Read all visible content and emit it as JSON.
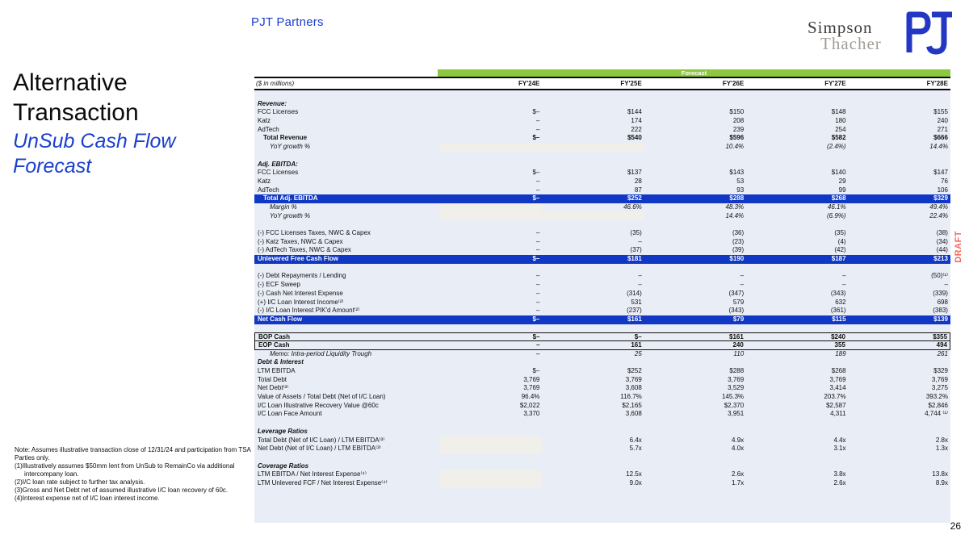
{
  "header": {
    "brand": "PJT Partners",
    "simpson_line1": "Simpson",
    "simpson_line2": "Thacher",
    "pjt_logo": "PJT"
  },
  "title": {
    "line1": "Alternative",
    "line2": "Transaction",
    "sub_line1": "UnSub Cash Flow",
    "sub_line2": "Forecast"
  },
  "watermark": "DRAFT",
  "page_number": "26",
  "colors": {
    "accent_blue": "#1b3cd0",
    "highlight_row_blue": "#1138c4",
    "forecast_green": "#8dc63f",
    "table_panel": "#e9edf6",
    "shaded_cell": "#f0efe9",
    "draft_red": "#f2685e"
  },
  "table": {
    "units_label": "($ in millions)",
    "forecast_label": "Forecast",
    "columns": [
      "FY'24E",
      "FY'25E",
      "FY'26E",
      "FY'27E",
      "FY'28E"
    ],
    "rows": [
      {
        "t": "spacer"
      },
      {
        "t": "section",
        "label": "Revenue:"
      },
      {
        "t": "item",
        "label": "FCC Licenses",
        "v": [
          "$–",
          "$144",
          "$150",
          "$148",
          "$155"
        ]
      },
      {
        "t": "item",
        "label": "Katz",
        "v": [
          "–",
          "174",
          "208",
          "180",
          "240"
        ]
      },
      {
        "t": "item",
        "label": "AdTech",
        "v": [
          "–",
          "222",
          "239",
          "254",
          "271"
        ]
      },
      {
        "t": "total",
        "label": "Total Revenue",
        "indent": 1,
        "v": [
          "$–",
          "$540",
          "$596",
          "$582",
          "$666"
        ]
      },
      {
        "t": "pct",
        "label": "YoY growth %",
        "indent": 2,
        "shade": 2,
        "v": [
          "",
          "",
          "10.4%",
          "(2.4%)",
          "14.4%"
        ]
      },
      {
        "t": "spacer"
      },
      {
        "t": "section",
        "label": "Adj. EBITDA:"
      },
      {
        "t": "item",
        "label": "FCC Licenses",
        "v": [
          "$–",
          "$137",
          "$143",
          "$140",
          "$147"
        ]
      },
      {
        "t": "item",
        "label": "Katz",
        "v": [
          "–",
          "28",
          "53",
          "29",
          "76"
        ]
      },
      {
        "t": "item",
        "label": "AdTech",
        "v": [
          "–",
          "87",
          "93",
          "99",
          "106"
        ]
      },
      {
        "t": "blue",
        "label": "Total Adj. EBITDA",
        "indent": 1,
        "v": [
          "$–",
          "$252",
          "$288",
          "$268",
          "$329"
        ]
      },
      {
        "t": "pct",
        "label": "Margin %",
        "indent": 2,
        "shade": 1,
        "v": [
          "",
          "46.6%",
          "48.3%",
          "46.1%",
          "49.4%"
        ]
      },
      {
        "t": "pct",
        "label": "YoY growth %",
        "indent": 2,
        "shade": 2,
        "v": [
          "",
          "",
          "14.4%",
          "(6.9%)",
          "22.4%"
        ]
      },
      {
        "t": "spacer"
      },
      {
        "t": "item",
        "label": "(-) FCC Licenses Taxes, NWC & Capex",
        "v": [
          "–",
          "(35)",
          "(36)",
          "(35)",
          "(38)"
        ]
      },
      {
        "t": "item",
        "label": "(-) Katz Taxes, NWC & Capex",
        "v": [
          "–",
          "–",
          "(23)",
          "(4)",
          "(34)"
        ]
      },
      {
        "t": "item",
        "label": "(-) AdTech Taxes, NWC & Capex",
        "v": [
          "–",
          "(37)",
          "(39)",
          "(42)",
          "(44)"
        ]
      },
      {
        "t": "blue",
        "label": "Unlevered Free Cash Flow",
        "v": [
          "$–",
          "$181",
          "$190",
          "$187",
          "$213"
        ]
      },
      {
        "t": "spacer"
      },
      {
        "t": "item",
        "label": "(-) Debt Repayments / Lending",
        "v": [
          "–",
          "–",
          "–",
          "–",
          "(50)⁽¹⁾"
        ]
      },
      {
        "t": "item",
        "label": "(-) ECF Sweep",
        "v": [
          "–",
          "–",
          "–",
          "–",
          "–"
        ]
      },
      {
        "t": "item",
        "label": "(-) Cash Net Interest Expense",
        "v": [
          "–",
          "(314)",
          "(347)",
          "(343)",
          "(339)"
        ]
      },
      {
        "t": "item",
        "label": "(+) I/C Loan Interest Income⁽²⁾",
        "v": [
          "–",
          "531",
          "579",
          "632",
          "698"
        ]
      },
      {
        "t": "item",
        "label": "(-) I/C Loan Interest PIK'd Amount⁽²⁾",
        "v": [
          "–",
          "(237)",
          "(343)",
          "(361)",
          "(383)"
        ]
      },
      {
        "t": "blue",
        "label": "Net Cash Flow",
        "v": [
          "$–",
          "$161",
          "$79",
          "$115",
          "$139"
        ]
      },
      {
        "t": "spacer"
      },
      {
        "t": "boxtop",
        "label": "BOP Cash",
        "v": [
          "$–",
          "$–",
          "$161",
          "$240",
          "$355"
        ]
      },
      {
        "t": "boxbottom",
        "label": "EOP Cash",
        "v": [
          "–",
          "161",
          "240",
          "355",
          "494"
        ]
      },
      {
        "t": "memo",
        "label": "Memo: Intra-period Liquidity Trough",
        "indent": 2,
        "v": [
          "–",
          "25",
          "110",
          "189",
          "261"
        ]
      },
      {
        "t": "section",
        "label": "Debt & Interest"
      },
      {
        "t": "item",
        "label": "LTM EBITDA",
        "v": [
          "$–",
          "$252",
          "$288",
          "$268",
          "$329"
        ]
      },
      {
        "t": "item",
        "label": "Total Debt",
        "v": [
          "3,769",
          "3,769",
          "3,769",
          "3,769",
          "3,769"
        ]
      },
      {
        "t": "item",
        "label": "Net Debt⁽³⁾",
        "v": [
          "3,769",
          "3,608",
          "3,529",
          "3,414",
          "3,275"
        ]
      },
      {
        "t": "item",
        "label": "Value of Assets / Total Debt (Net of I/C Loan)",
        "v": [
          "96.4%",
          "116.7%",
          "145.3%",
          "203.7%",
          "393.2%"
        ]
      },
      {
        "t": "item",
        "label": "I/C Loan Illustrative Recovery Value @60c",
        "v": [
          "$2,022",
          "$2,165",
          "$2,370",
          "$2,587",
          "$2,846"
        ]
      },
      {
        "t": "item",
        "label": "I/C Loan Face Amount",
        "v": [
          "3,370",
          "3,608",
          "3,951",
          "4,311",
          "4,744 ⁽¹⁾"
        ]
      },
      {
        "t": "spacer"
      },
      {
        "t": "section",
        "label": "Leverage Ratios"
      },
      {
        "t": "item",
        "label": "Total Debt (Net of I/C Loan) / LTM EBITDA⁽³⁾",
        "shade": 1,
        "v": [
          "",
          "6.4x",
          "4.9x",
          "4.4x",
          "2.8x"
        ]
      },
      {
        "t": "item",
        "label": "Net Debt (Net of I/C Loan) / LTM EBITDA⁽³⁾",
        "shade": 1,
        "v": [
          "",
          "5.7x",
          "4.0x",
          "3.1x",
          "1.3x"
        ]
      },
      {
        "t": "spacer"
      },
      {
        "t": "section",
        "label": "Coverage Ratios"
      },
      {
        "t": "item",
        "label": "LTM EBITDA / Net Interest Expense⁽⁴⁾",
        "shade": 1,
        "v": [
          "",
          "12.5x",
          "2.6x",
          "3.8x",
          "13.8x"
        ]
      },
      {
        "t": "item",
        "label": "LTM Unlevered FCF / Net Interest Expense⁽⁴⁾",
        "shade": 1,
        "v": [
          "",
          "9.0x",
          "1.7x",
          "2.6x",
          "8.9x"
        ]
      }
    ]
  },
  "footnotes": [
    "Note: Assumes illustrative transaction close of 12/31/24 and participation from TSA Parties only.",
    "(1)Illustratively assumes $50mm lent from UnSub to RemainCo via additional intercompany loan.",
    "(2)I/C loan rate subject to further tax analysis.",
    "(3)Gross and Net Debt net of assumed illustrative I/C loan recovery of 60c.",
    "(4)Interest expense net of I/C loan interest income."
  ]
}
